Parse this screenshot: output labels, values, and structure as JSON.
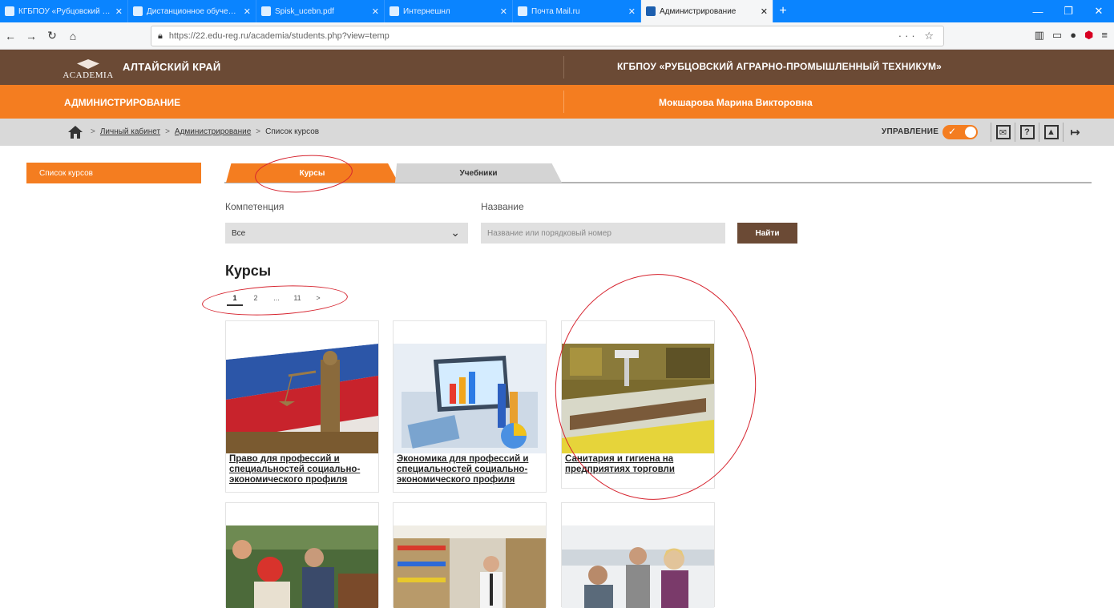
{
  "browser": {
    "tabs": [
      {
        "title": "КГБПОУ «Рубцовский аграр..."
      },
      {
        "title": "Дистанционное обучение"
      },
      {
        "title": "Spisk_ucebn.pdf"
      },
      {
        "title": "Интернешнл"
      },
      {
        "title": "Почта Mail.ru"
      },
      {
        "title": "Администрирование",
        "active": true
      }
    ],
    "new_tab": "+",
    "url": "https://22.edu-reg.ru/academia/students.php?view=temp"
  },
  "site": {
    "logo_text": "ACADEMIA",
    "region": "АЛТАЙСКИЙ КРАЙ",
    "organization": "КГБПОУ «РУБЦОВСКИЙ АГРАРНО-ПРОМЫШЛЕННЫЙ ТЕХНИКУМ»",
    "section": "АДМИНИСТРИРОВАНИЕ",
    "user": "Мокшарова Марина Викторовна"
  },
  "breadcrumb": {
    "items": [
      "Личный кабинет",
      "Администрирование",
      "Список курсов"
    ],
    "separator": ">"
  },
  "manage": {
    "label": "УПРАВЛЕНИЕ",
    "enabled": true
  },
  "header_icons": [
    "mail-icon",
    "help-icon",
    "profile-icon",
    "logout-icon"
  ],
  "sidebar": {
    "items": [
      {
        "label": "Список курсов"
      }
    ]
  },
  "tabs": [
    {
      "label": "Курсы",
      "active": true
    },
    {
      "label": "Учебники",
      "active": false
    }
  ],
  "filters": {
    "competence_label": "Компетенция",
    "competence_value": "Все",
    "name_label": "Название",
    "name_placeholder": "Название или порядковый номер",
    "find_label": "Найти"
  },
  "courses_title": "Курсы",
  "pager": [
    "1",
    "2",
    "...",
    "11",
    ">"
  ],
  "courses": [
    {
      "title": "Право для профессий и специальностей социально-экономического профиля",
      "image": "justice-statue"
    },
    {
      "title": "Экономика для профессий и специальностей социально-экономического профиля",
      "image": "laptop-charts"
    },
    {
      "title": "Санитария и гигиена на предприятиях торговли",
      "image": "shop-display"
    },
    {
      "title": "",
      "image": "rescue-team"
    },
    {
      "title": "",
      "image": "store-aisle"
    },
    {
      "title": "",
      "image": "office-people"
    }
  ],
  "colors": {
    "brown": "#6b4a35",
    "orange": "#f47d20",
    "browser_blue": "#0a84ff"
  }
}
